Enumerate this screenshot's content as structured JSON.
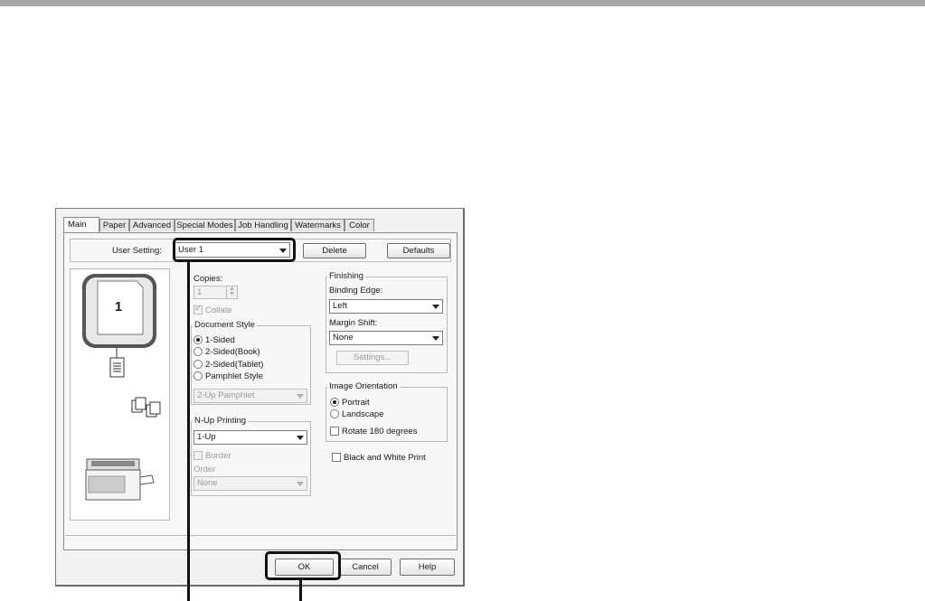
{
  "dialog": {
    "tabs": [
      {
        "label": "Main"
      },
      {
        "label": "Paper"
      },
      {
        "label": "Advanced"
      },
      {
        "label": "Special Modes"
      },
      {
        "label": "Job Handling"
      },
      {
        "label": "Watermarks"
      },
      {
        "label": "Color"
      }
    ],
    "active_tab": "Main",
    "user_setting": {
      "label": "User Setting:",
      "value": "User 1"
    },
    "delete_label": "Delete",
    "defaults_label": "Defaults",
    "preview": {
      "page_number": "1"
    },
    "copies": {
      "label": "Copies:",
      "value": "1"
    },
    "collate_label": "Collate",
    "document_style": {
      "label": "Document Style",
      "options": [
        "1-Sided",
        "2-Sided(Book)",
        "2-Sided(Tablet)",
        "Pamphlet Style"
      ],
      "selected": "1-Sided",
      "pamphlet_value": "2-Up Pamphlet"
    },
    "nup": {
      "label": "N-Up Printing",
      "value": "1-Up",
      "border_label": "Border",
      "order_label": "Order",
      "order_value": "None"
    },
    "finishing": {
      "label": "Finishing",
      "binding_label": "Binding Edge:",
      "binding_value": "Left",
      "margin_label": "Margin Shift:",
      "margin_value": "None",
      "settings_label": "Settings..."
    },
    "orientation": {
      "label": "Image Orientation",
      "options": [
        "Portrait",
        "Landscape"
      ],
      "selected": "Portrait",
      "rotate_label": "Rotate 180 degrees"
    },
    "bw_label": "Black and White Print",
    "ok_label": "OK",
    "cancel_label": "Cancel",
    "help_label": "Help"
  }
}
